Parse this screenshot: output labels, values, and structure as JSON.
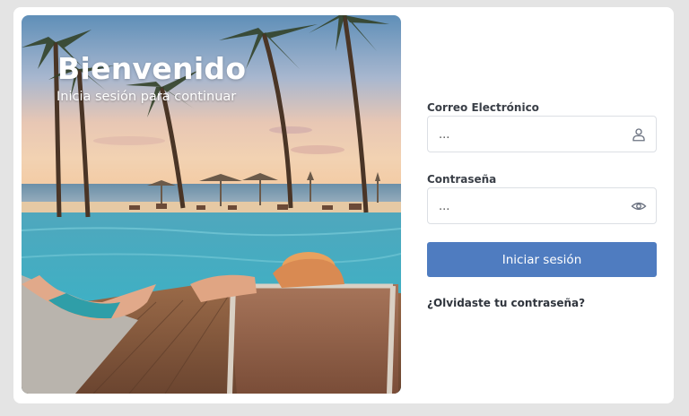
{
  "hero": {
    "title": "Bienvenido",
    "subtitle": "Inicia sesión para continuar"
  },
  "form": {
    "email_label": "Correo Electrónico",
    "email_placeholder": "...",
    "email_icon": "user-icon",
    "password_label": "Contraseña",
    "password_placeholder": "...",
    "password_icon": "eye-icon",
    "submit_label": "Iniciar sesión",
    "forgot_label": "¿Olvidaste tu contraseña?"
  },
  "colors": {
    "page_background": "#e4e4e4",
    "card_background": "#ffffff",
    "button_background": "#4f7cc0",
    "button_text": "#ffffff",
    "label_text": "#3a3f47"
  }
}
